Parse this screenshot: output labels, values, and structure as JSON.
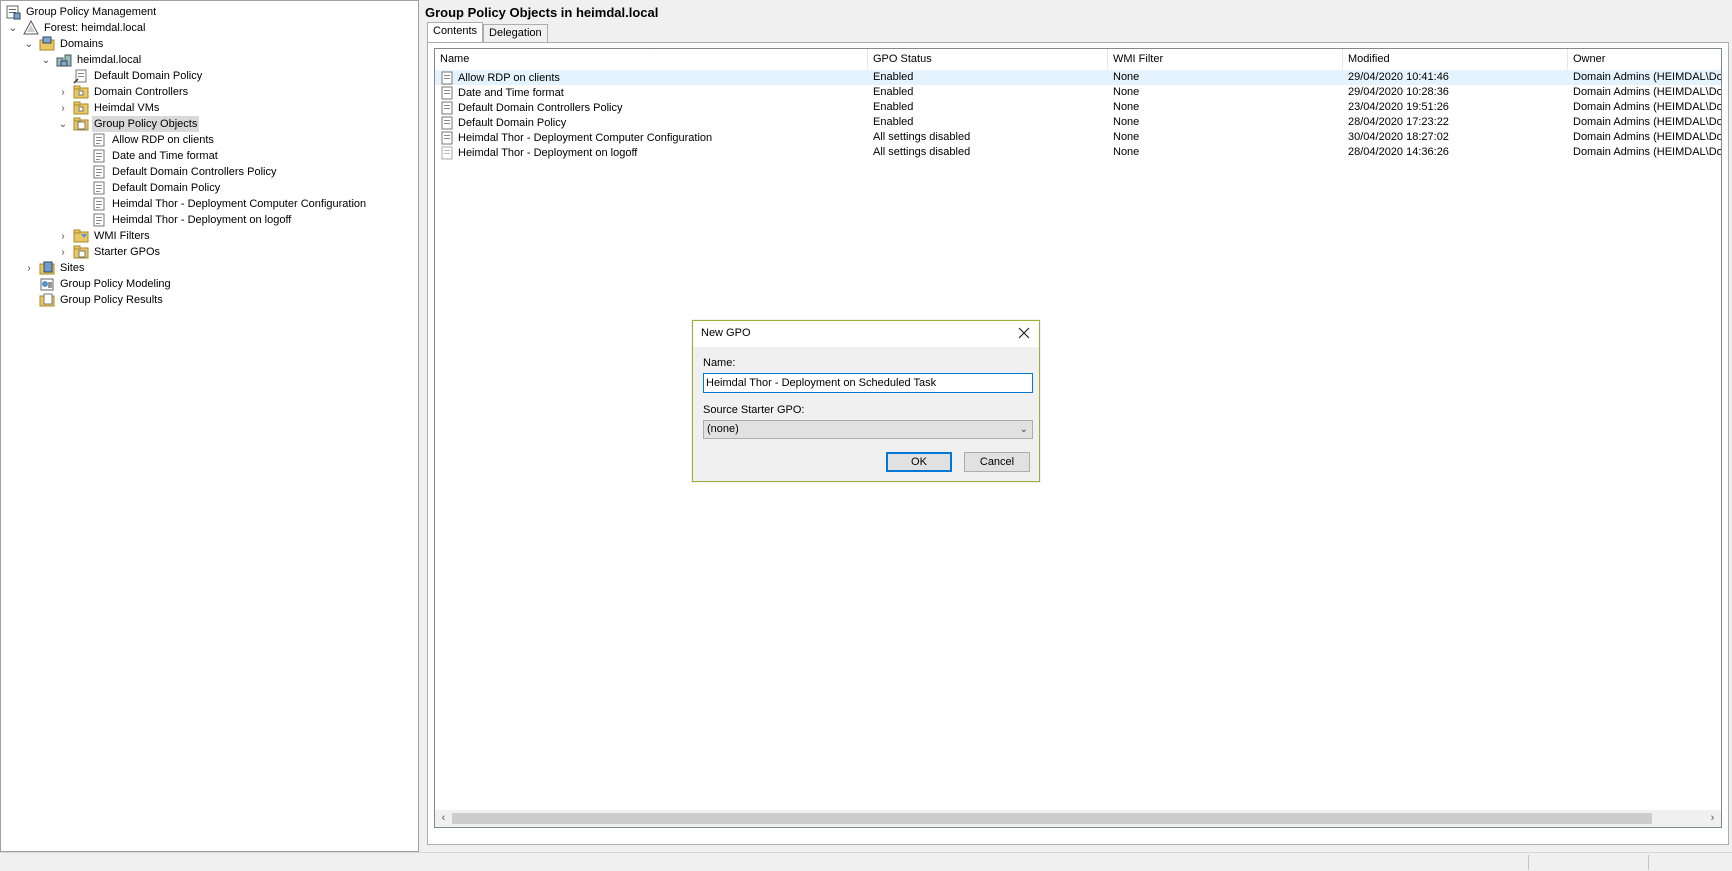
{
  "tree": {
    "root": "Group Policy Management",
    "forest": "Forest: heimdal.local",
    "domains": "Domains",
    "domain": "heimdal.local",
    "default_domain_policy": "Default Domain Policy",
    "domain_controllers": "Domain Controllers",
    "heimdal_vms": "Heimdal VMs",
    "gpo_folder": "Group Policy Objects",
    "gpo_children": [
      "Allow RDP on clients",
      "Date and Time format",
      "Default Domain Controllers Policy",
      "Default Domain Policy",
      "Heimdal Thor - Deployment Computer Configuration",
      "Heimdal Thor - Deployment on logoff"
    ],
    "wmi_filters": "WMI Filters",
    "starter_gpos": "Starter GPOs",
    "sites": "Sites",
    "modeling": "Group Policy Modeling",
    "results": "Group Policy Results"
  },
  "main": {
    "title": "Group Policy Objects in heimdal.local",
    "tabs": [
      "Contents",
      "Delegation"
    ],
    "columns": [
      "Name",
      "GPO Status",
      "WMI Filter",
      "Modified",
      "Owner"
    ],
    "rows": [
      [
        "Allow RDP on clients",
        "Enabled",
        "None",
        "29/04/2020 10:41:46",
        "Domain Admins (HEIMDAL\\Dom"
      ],
      [
        "Date and Time format",
        "Enabled",
        "None",
        "29/04/2020 10:28:36",
        "Domain Admins (HEIMDAL\\Dom"
      ],
      [
        "Default Domain Controllers Policy",
        "Enabled",
        "None",
        "23/04/2020 19:51:26",
        "Domain Admins (HEIMDAL\\Dom"
      ],
      [
        "Default Domain Policy",
        "Enabled",
        "None",
        "28/04/2020 17:23:22",
        "Domain Admins (HEIMDAL\\Dom"
      ],
      [
        "Heimdal Thor - Deployment Computer Configuration",
        "All settings disabled",
        "None",
        "30/04/2020 18:27:02",
        "Domain Admins (HEIMDAL\\Dom"
      ],
      [
        "Heimdal Thor - Deployment on logoff",
        "All settings disabled",
        "None",
        "28/04/2020 14:36:26",
        "Domain Admins (HEIMDAL\\Dom"
      ]
    ]
  },
  "dialog": {
    "title": "New GPO",
    "name_label": "Name:",
    "name_value": "Heimdal Thor - Deployment on Scheduled Task",
    "starter_label": "Source Starter GPO:",
    "starter_value": "(none)",
    "ok": "OK",
    "cancel": "Cancel"
  },
  "colors": {
    "dialog_border": "#9cad39",
    "focus_blue": "#0078d7",
    "row_highlight": "#e5f3ff"
  },
  "icons": {
    "gpo": "gpo-scroll-icon",
    "folder": "ou-folder-icon"
  }
}
